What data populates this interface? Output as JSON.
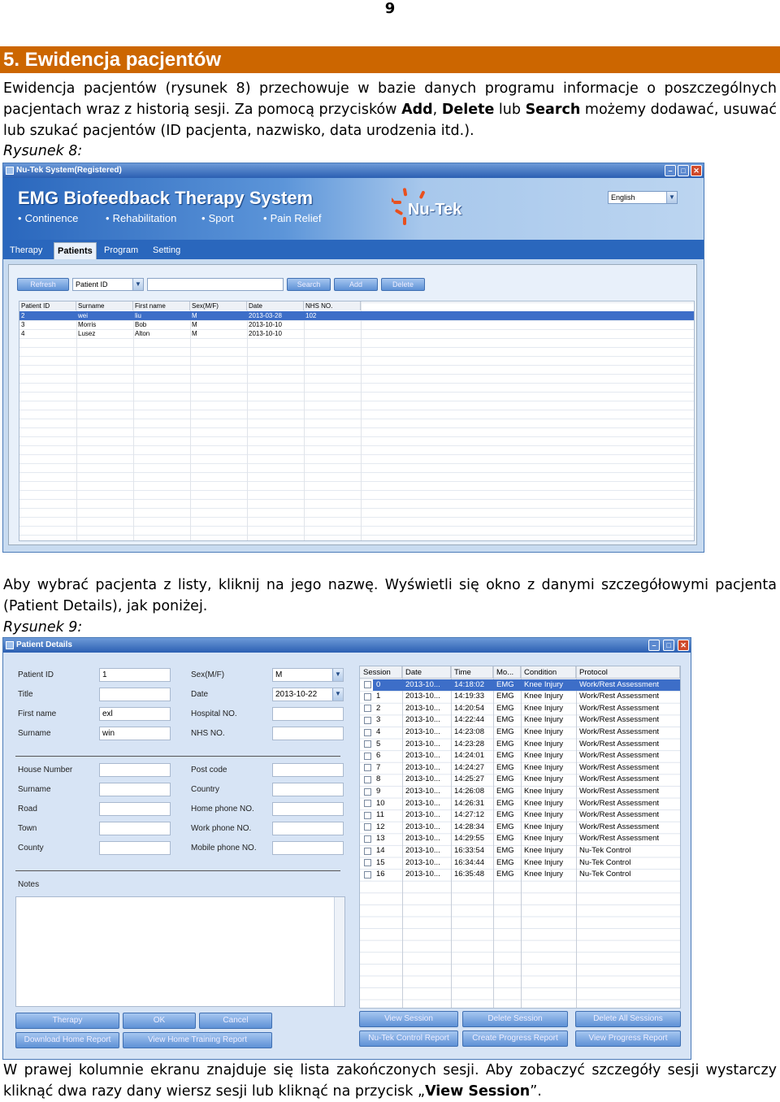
{
  "page_number": "9",
  "section_title": "5. Ewidencja pacjentów",
  "para1": {
    "p1": "Ewidencja pacjentów (rysunek 8) przechowuje w bazie danych programu informacje o poszczególnych pacjentach wraz z historią sesji. Za pomocą przycisków ",
    "b1": "Add",
    "p2": ", ",
    "b2": "Delete",
    "p3": " lub ",
    "b3": "Search",
    "p4": " możemy dodawać, usuwać lub szukać pacjentów (ID pacjenta, nazwisko, data urodzenia itd.)."
  },
  "caption8": "Rysunek 8:",
  "para2": "Aby wybrać pacjenta z listy, kliknij na jego nazwę. Wyświetli się okno z danymi szczegółowymi pacjenta (Patient Details), jak poniżej.",
  "caption9": "Rysunek 9:",
  "para3": {
    "p1": "W prawej kolumnie ekranu znajduje się lista zakończonych sesji. Aby zobaczyć szczegóły sesji wystarczy kliknąć dwa razy dany wiersz sesji lub kliknąć na przycisk „",
    "b1": "View Session",
    "p2": "”."
  },
  "win1": {
    "title": "Nu-Tek System(Registered)",
    "app_title": "EMG Biofeedback Therapy System",
    "features": [
      "Continence",
      "Rehabilitation",
      "Sport",
      "Pain Relief"
    ],
    "brand": "Nu-Tek",
    "language": "English",
    "tabs": [
      "Therapy",
      "Patients",
      "Program",
      "Setting"
    ],
    "refresh": "Refresh",
    "search_field": "Patient ID",
    "search": "Search",
    "add": "Add",
    "delete": "Delete",
    "columns": [
      "Patient ID",
      "Surname",
      "First name",
      "Sex(M/F)",
      "Date",
      "NHS NO."
    ],
    "rows": [
      [
        "2",
        "wei",
        "liu",
        "M",
        "2013-03-28",
        "102"
      ],
      [
        "3",
        "Morris",
        "Bob",
        "M",
        "2013-10-10",
        ""
      ],
      [
        "4",
        "Lusez",
        "Alton",
        "M",
        "2013-10-10",
        ""
      ]
    ]
  },
  "win2": {
    "title": "Patient Details",
    "labels": {
      "patient_id": "Patient ID",
      "title": "Title",
      "first_name": "First name",
      "surname": "Surname",
      "sex": "Sex(M/F)",
      "date": "Date",
      "hospital": "Hospital NO.",
      "nhs": "NHS NO.",
      "house": "House Number",
      "surname2": "Surname",
      "road": "Road",
      "town": "Town",
      "county": "County",
      "postcode": "Post code",
      "country": "Country",
      "home_phone": "Home phone NO.",
      "work_phone": "Work phone NO.",
      "mobile": "Mobile phone NO.",
      "notes": "Notes"
    },
    "values": {
      "patient_id": "1",
      "first_name": "exl",
      "surname": "win",
      "sex": "M",
      "date": "2013-10-22"
    },
    "session_columns": [
      "Session",
      "Date",
      "Time",
      "Mo...",
      "Condition",
      "Protocol"
    ],
    "sessions": [
      [
        "0",
        "2013-10...",
        "14:18:02",
        "EMG",
        "Knee Injury",
        "Work/Rest Assessment"
      ],
      [
        "1",
        "2013-10...",
        "14:19:33",
        "EMG",
        "Knee Injury",
        "Work/Rest Assessment"
      ],
      [
        "2",
        "2013-10...",
        "14:20:54",
        "EMG",
        "Knee Injury",
        "Work/Rest Assessment"
      ],
      [
        "3",
        "2013-10...",
        "14:22:44",
        "EMG",
        "Knee Injury",
        "Work/Rest Assessment"
      ],
      [
        "4",
        "2013-10...",
        "14:23:08",
        "EMG",
        "Knee Injury",
        "Work/Rest Assessment"
      ],
      [
        "5",
        "2013-10...",
        "14:23:28",
        "EMG",
        "Knee Injury",
        "Work/Rest Assessment"
      ],
      [
        "6",
        "2013-10...",
        "14:24:01",
        "EMG",
        "Knee Injury",
        "Work/Rest Assessment"
      ],
      [
        "7",
        "2013-10...",
        "14:24:27",
        "EMG",
        "Knee Injury",
        "Work/Rest Assessment"
      ],
      [
        "8",
        "2013-10...",
        "14:25:27",
        "EMG",
        "Knee Injury",
        "Work/Rest Assessment"
      ],
      [
        "9",
        "2013-10...",
        "14:26:08",
        "EMG",
        "Knee Injury",
        "Work/Rest Assessment"
      ],
      [
        "10",
        "2013-10...",
        "14:26:31",
        "EMG",
        "Knee Injury",
        "Work/Rest Assessment"
      ],
      [
        "11",
        "2013-10...",
        "14:27:12",
        "EMG",
        "Knee Injury",
        "Work/Rest Assessment"
      ],
      [
        "12",
        "2013-10...",
        "14:28:34",
        "EMG",
        "Knee Injury",
        "Work/Rest Assessment"
      ],
      [
        "13",
        "2013-10...",
        "14:29:55",
        "EMG",
        "Knee Injury",
        "Work/Rest Assessment"
      ],
      [
        "14",
        "2013-10...",
        "16:33:54",
        "EMG",
        "Knee Injury",
        "Nu-Tek Control"
      ],
      [
        "15",
        "2013-10...",
        "16:34:44",
        "EMG",
        "Knee Injury",
        "Nu-Tek Control"
      ],
      [
        "16",
        "2013-10...",
        "16:35:48",
        "EMG",
        "Knee Injury",
        "Nu-Tek Control"
      ]
    ],
    "buttons": {
      "therapy": "Therapy",
      "ok": "OK",
      "cancel": "Cancel",
      "download": "Download Home Report",
      "view_home": "View Home Training Report",
      "view_session": "View Session",
      "delete_session": "Delete Session",
      "delete_all": "Delete All Sessions",
      "control_report": "Nu-Tek Control Report",
      "create_progress": "Create Progress Report",
      "view_progress": "View Progress Report"
    }
  },
  "colors": {
    "section_bar": "#cc6600",
    "window_blue": "#2a67bd",
    "selection": "#3d6ec8"
  }
}
